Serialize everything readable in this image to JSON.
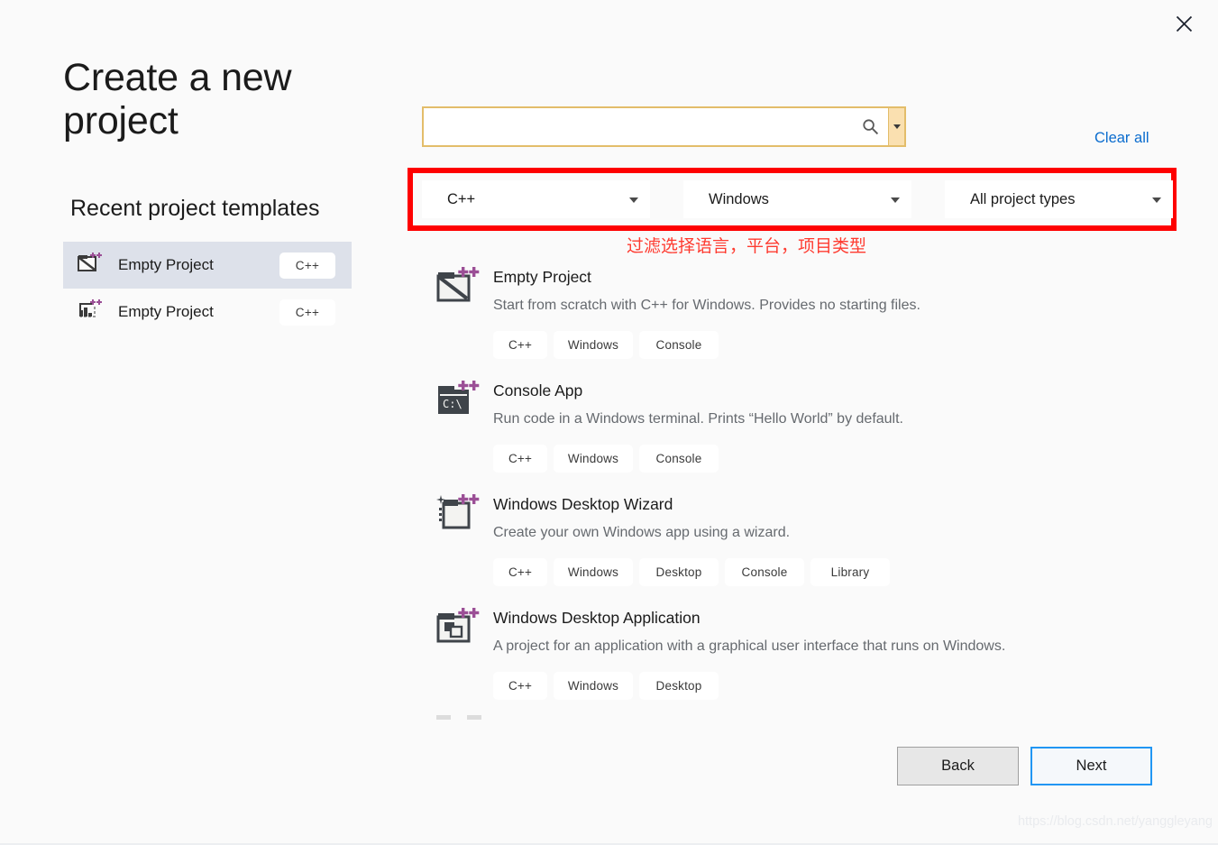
{
  "window": {
    "close_icon": "close-icon",
    "background_color": "#fafafa"
  },
  "header": {
    "title": "Create a new project"
  },
  "sidebar": {
    "heading": "Recent project templates",
    "items": [
      {
        "label": "Empty Project",
        "badge": "C++",
        "icon": "empty-project-icon",
        "selected": true
      },
      {
        "label": "Empty Project",
        "badge": "C++",
        "icon": "empty-project-lib-icon",
        "selected": false
      }
    ],
    "selected_color": "#dde1ea"
  },
  "search": {
    "value": "",
    "placeholder": "",
    "search_icon": "search-icon",
    "dropdown_icon": "chevron-down-icon",
    "border_color": "#e3bd6a",
    "dropdown_bg": "#fae0b0"
  },
  "clear_all": {
    "label": "Clear all",
    "color": "#0a6cce"
  },
  "filters": {
    "annotation_color": "#fe0000",
    "annotation_text": "过滤选择语言，平台，项目类型",
    "annotation_text_color": "#fe3b30",
    "selects": [
      {
        "name": "language",
        "value": "C++"
      },
      {
        "name": "platform",
        "value": "Windows"
      },
      {
        "name": "project-type",
        "value": "All project types"
      }
    ]
  },
  "templates": [
    {
      "name": "Empty Project",
      "description": "Start from scratch with C++ for Windows. Provides no starting files.",
      "icon": "empty-project-icon",
      "tags": [
        "C++",
        "Windows",
        "Console"
      ]
    },
    {
      "name": "Console App",
      "description": "Run code in a Windows terminal. Prints “Hello World” by default.",
      "icon": "console-app-icon",
      "tags": [
        "C++",
        "Windows",
        "Console"
      ]
    },
    {
      "name": "Windows Desktop Wizard",
      "description": "Create your own Windows app using a wizard.",
      "icon": "desktop-wizard-icon",
      "tags": [
        "C++",
        "Windows",
        "Desktop",
        "Console",
        "Library"
      ]
    },
    {
      "name": "Windows Desktop Application",
      "description": "A project for an application with a graphical user interface that runs on Windows.",
      "icon": "desktop-application-icon",
      "tags": [
        "C++",
        "Windows",
        "Desktop"
      ]
    }
  ],
  "footer": {
    "back_label": "Back",
    "next_label": "Next",
    "next_accent": "#2196f3"
  },
  "watermark": {
    "text": "https://blog.csdn.net/yanggleyang"
  }
}
